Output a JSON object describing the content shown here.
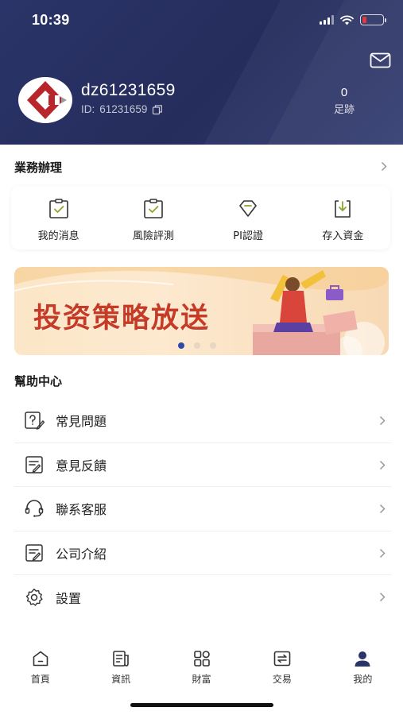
{
  "status_bar": {
    "time": "10:39"
  },
  "profile": {
    "username": "dz61231659",
    "id_label": "ID:",
    "id_value": "61231659",
    "footprint_count": "0",
    "footprint_label": "足跡"
  },
  "business": {
    "title": "業務辦理",
    "items": [
      {
        "label": "我的消息",
        "icon": "message-clipboard-icon"
      },
      {
        "label": "風險評測",
        "icon": "risk-clipboard-icon"
      },
      {
        "label": "PI認證",
        "icon": "diamond-icon"
      },
      {
        "label": "存入資金",
        "icon": "deposit-icon"
      }
    ]
  },
  "banner": {
    "text": "投资策略放送",
    "active_slide": 1,
    "slide_count": 3
  },
  "help": {
    "title": "幫助中心",
    "items": [
      {
        "label": "常見問題",
        "icon": "question-doc-icon"
      },
      {
        "label": "意見反饋",
        "icon": "feedback-doc-icon"
      },
      {
        "label": "聯系客服",
        "icon": "headset-icon"
      },
      {
        "label": "公司介紹",
        "icon": "company-doc-icon"
      },
      {
        "label": "設置",
        "icon": "gear-icon"
      }
    ]
  },
  "tabbar": {
    "items": [
      {
        "label": "首頁",
        "icon": "home-icon",
        "active": false
      },
      {
        "label": "資訊",
        "icon": "news-icon",
        "active": false
      },
      {
        "label": "財富",
        "icon": "grid-icon",
        "active": false
      },
      {
        "label": "交易",
        "icon": "exchange-icon",
        "active": false
      },
      {
        "label": "我的",
        "icon": "user-icon",
        "active": true
      }
    ]
  },
  "colors": {
    "header_bg": "#262e5e",
    "accent_blue": "#2f4aa8",
    "banner_red": "#c53b26",
    "icon_green": "#7a9a2e"
  }
}
